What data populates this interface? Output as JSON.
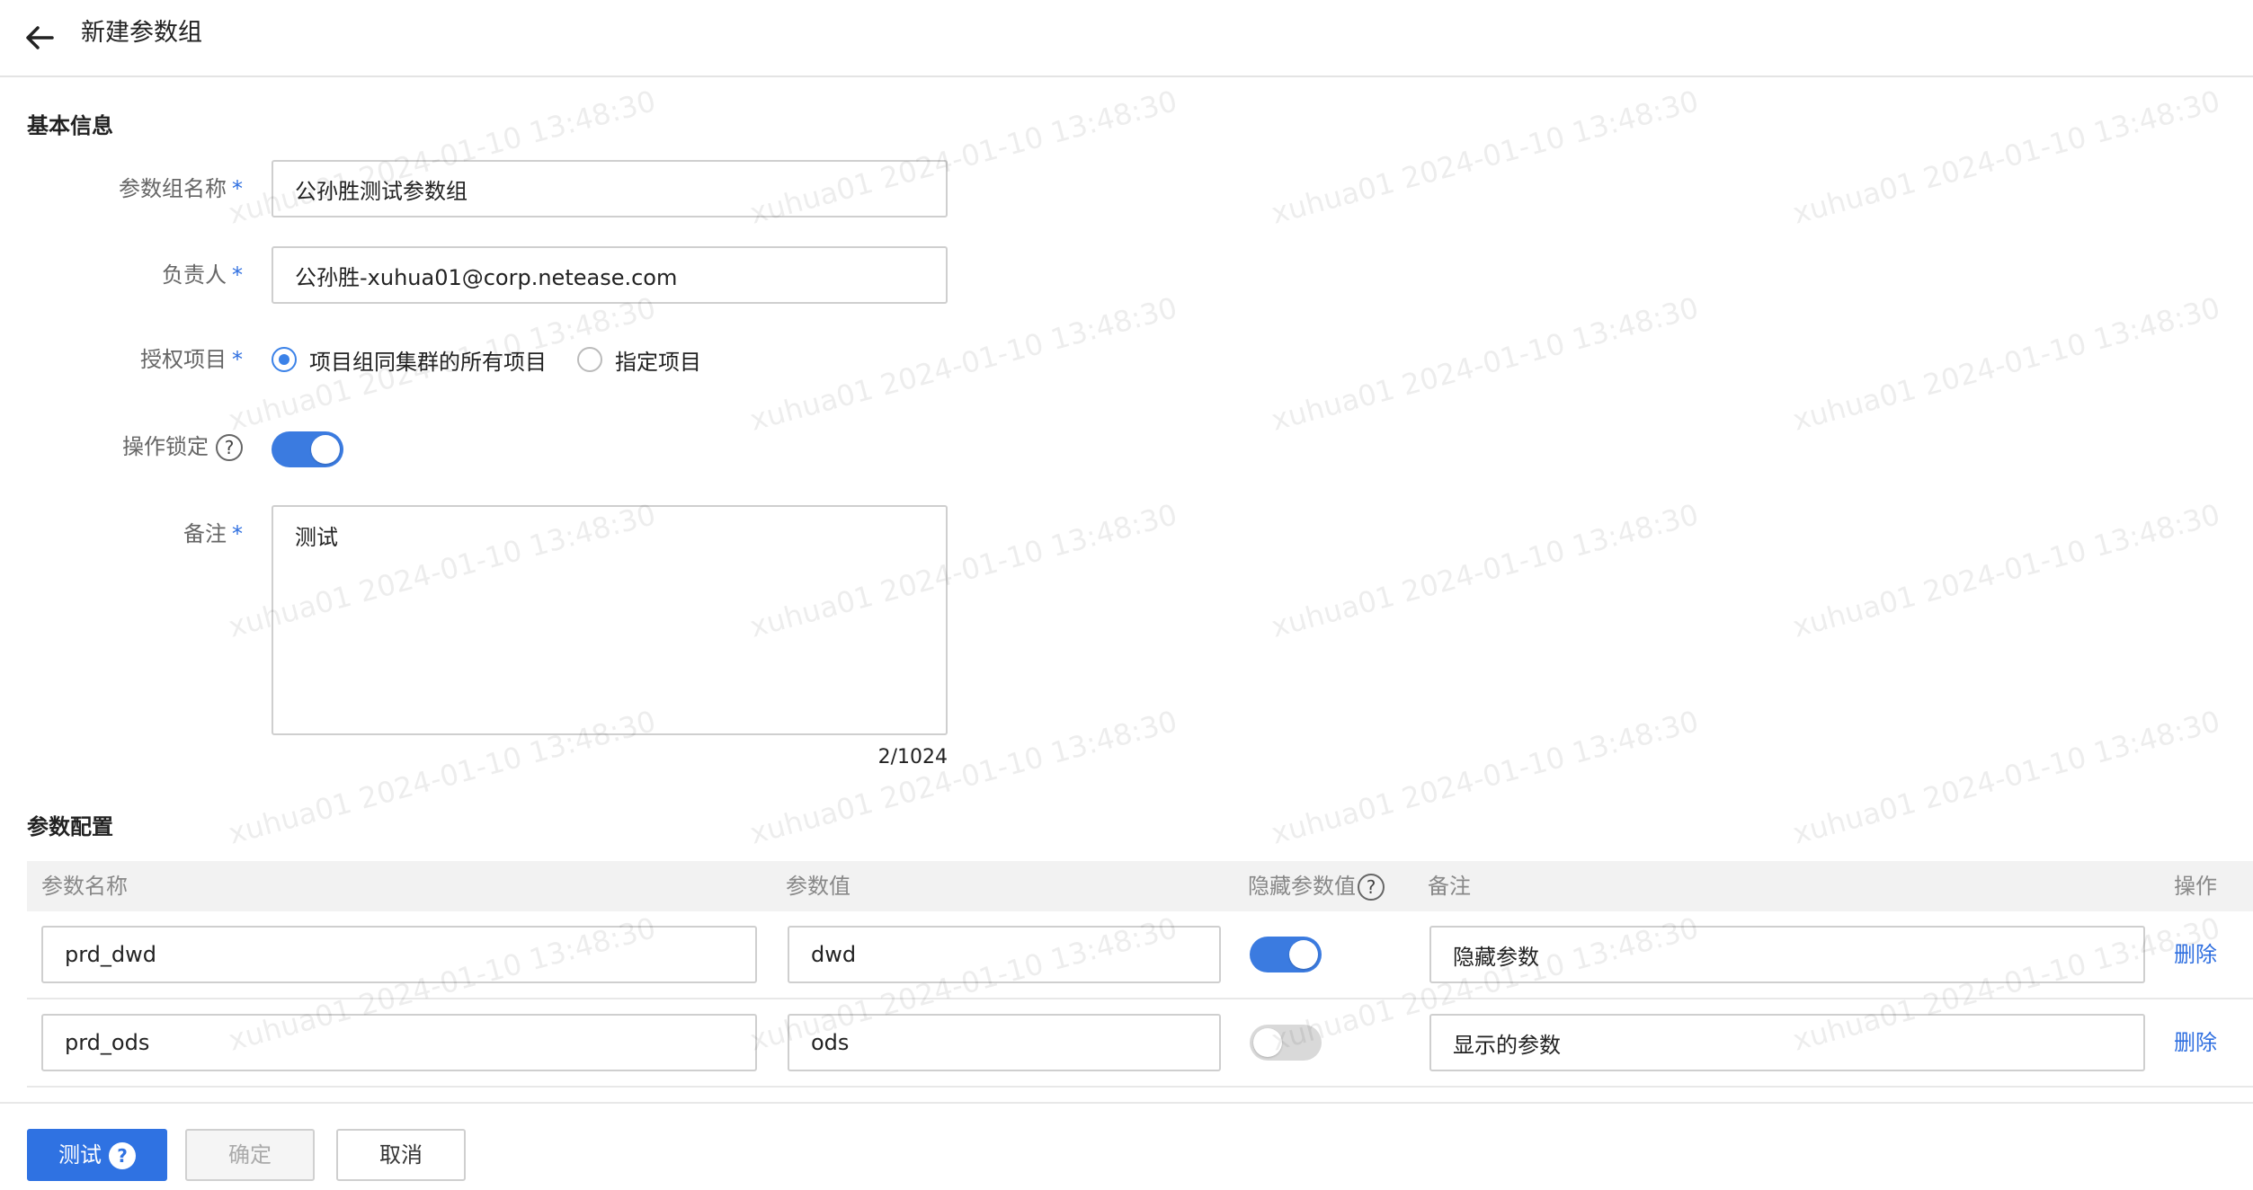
{
  "header": {
    "title": "新建参数组"
  },
  "basic_info": {
    "section_title": "基本信息",
    "group_name": {
      "label": "参数组名称",
      "required_mark": "*",
      "value": "公孙胜测试参数组"
    },
    "owner": {
      "label": "负责人",
      "required_mark": "*",
      "value": "公孙胜-xuhua01@corp.netease.com"
    },
    "auth_project": {
      "label": "授权项目",
      "required_mark": "*",
      "options": [
        {
          "label": "项目组同集群的所有项目",
          "checked": true
        },
        {
          "label": "指定项目",
          "checked": false
        }
      ]
    },
    "lock": {
      "label": "操作锁定",
      "help": "?",
      "enabled": true
    },
    "remark": {
      "label": "备注",
      "required_mark": "*",
      "value": "测试",
      "counter": "2/1024"
    }
  },
  "param_config": {
    "section_title": "参数配置",
    "columns": [
      "参数名称",
      "参数值",
      "隐藏参数值",
      "备注",
      "操作"
    ],
    "column_help": "?",
    "rows": [
      {
        "name": "prd_dwd",
        "value": "dwd",
        "hidden": true,
        "remark": "隐藏参数",
        "action": "删除"
      },
      {
        "name": "prd_ods",
        "value": "ods",
        "hidden": false,
        "remark": "显示的参数",
        "action": "删除"
      }
    ]
  },
  "footer": {
    "test_label": "测试",
    "test_help": "?",
    "confirm_label": "确定",
    "cancel_label": "取消"
  },
  "watermark": {
    "text": "xuhua01 2024-01-10 13:48:30"
  },
  "colors": {
    "accent": "#2f72e2",
    "toggle_off": "#d9d9d9",
    "link": "#2f6fe0"
  }
}
